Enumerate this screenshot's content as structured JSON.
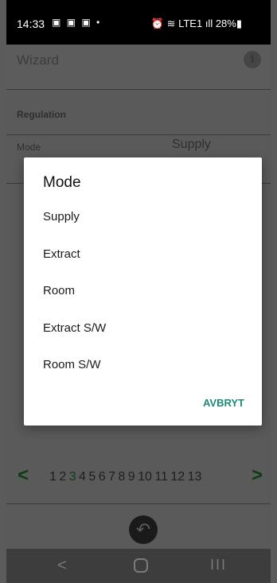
{
  "status_bar": {
    "time": "14:33",
    "notifications": "▣ ▣ ▣ •",
    "icons_right": "⏰ ≋ LTE1 ıll 28%▮"
  },
  "app_bar": {
    "title": "Wizard",
    "info_icon": "i"
  },
  "section": {
    "title": "Regulation"
  },
  "mode_row": {
    "label": "Mode",
    "value": "Supply"
  },
  "dialog": {
    "title": "Mode",
    "options": [
      "Supply",
      "Extract",
      "Room",
      "Extract S/W",
      "Room S/W"
    ],
    "cancel_label": "AVBRYT"
  },
  "pager": {
    "prev": "<",
    "next": ">",
    "pages_before": "1 2 ",
    "current": "3",
    "pages_after": " 4 5 6 7 8 9 10 11 12 13"
  },
  "undo_icon": "↶",
  "navbar": {
    "back": "<",
    "recents": "III"
  },
  "colors": {
    "accent": "#1b8b76",
    "pager_green": "#0b3d12"
  }
}
